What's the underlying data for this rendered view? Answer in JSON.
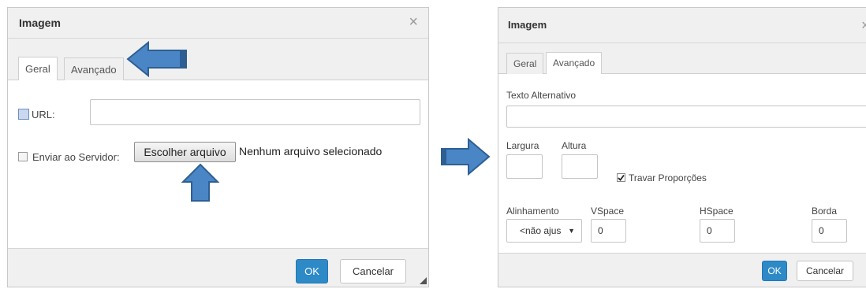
{
  "left_dialog": {
    "title": "Imagem",
    "close_glyph": "×",
    "tabs": [
      "Geral",
      "Avançado"
    ],
    "url_label": "URL:",
    "url_value": "",
    "upload_label": "Enviar ao Servidor:",
    "choose_file_label": "Escolher arquivo",
    "no_file_text": "Nenhum arquivo selecionado",
    "ok_label": "OK",
    "cancel_label": "Cancelar"
  },
  "right_dialog": {
    "title": "Imagem",
    "close_glyph": "×",
    "tabs": [
      "Geral",
      "Avançado"
    ],
    "alt_label": "Texto Alternativo",
    "alt_value": "",
    "width_label": "Largura",
    "width_value": "",
    "height_label": "Altura",
    "height_value": "",
    "lock_label": "Travar Proporções",
    "lock_checked": true,
    "align_label": "Alinhamento",
    "align_value": "<não ajus",
    "vspace_label": "VSpace",
    "vspace_value": "0",
    "hspace_label": "HSpace",
    "hspace_value": "0",
    "border_label": "Borda",
    "border_value": "0",
    "ok_label": "OK",
    "cancel_label": "Cancelar"
  },
  "colors": {
    "arrow_fill": "#4a86c5",
    "ok_button": "#2d8ac7",
    "header_bg": "#f0f0f0"
  }
}
